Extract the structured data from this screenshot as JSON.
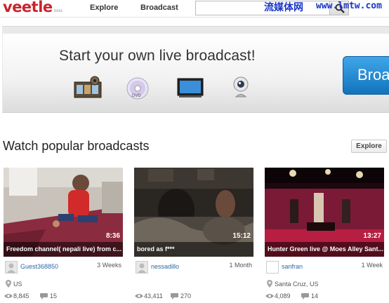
{
  "header": {
    "logo": "veetle",
    "beta": "beta",
    "nav_explore": "Explore",
    "nav_broadcast": "Broadcast",
    "search_placeholder": "",
    "watermark_cn": "流媒体网",
    "watermark_url": "www.lmtw.com"
  },
  "banner": {
    "title": "Start your own live broadcast!",
    "cta_label": "Broa",
    "icons": [
      "film-reel-icon",
      "dvd-disc-icon",
      "monitor-icon",
      "webcam-icon"
    ]
  },
  "popular": {
    "title": "Watch popular broadcasts",
    "explore_label": "Explore"
  },
  "broadcasts": [
    {
      "title": "Freedom channel( nepali live) from c...",
      "duration": "8:36",
      "user": "Guest368850",
      "age": "3 Weeks",
      "location": "US",
      "views": "8,845",
      "comments": "15"
    },
    {
      "title": "bored as f***",
      "duration": "15:12",
      "user": "nessadillo",
      "age": "1 Month",
      "location": "",
      "views": "43,411",
      "comments": "270"
    },
    {
      "title": "Hunter Green live @ Moes Alley Sant...",
      "duration": "13:27",
      "user": "sanfran",
      "age": "1 Week",
      "location": "Santa Cruz, US",
      "views": "4,089",
      "comments": "14"
    }
  ],
  "colors": {
    "brand_red": "#c8242c",
    "link_blue": "#2a6aa6",
    "cta_blue": "#1c86d4",
    "watermark_blue": "#1a35c8"
  }
}
